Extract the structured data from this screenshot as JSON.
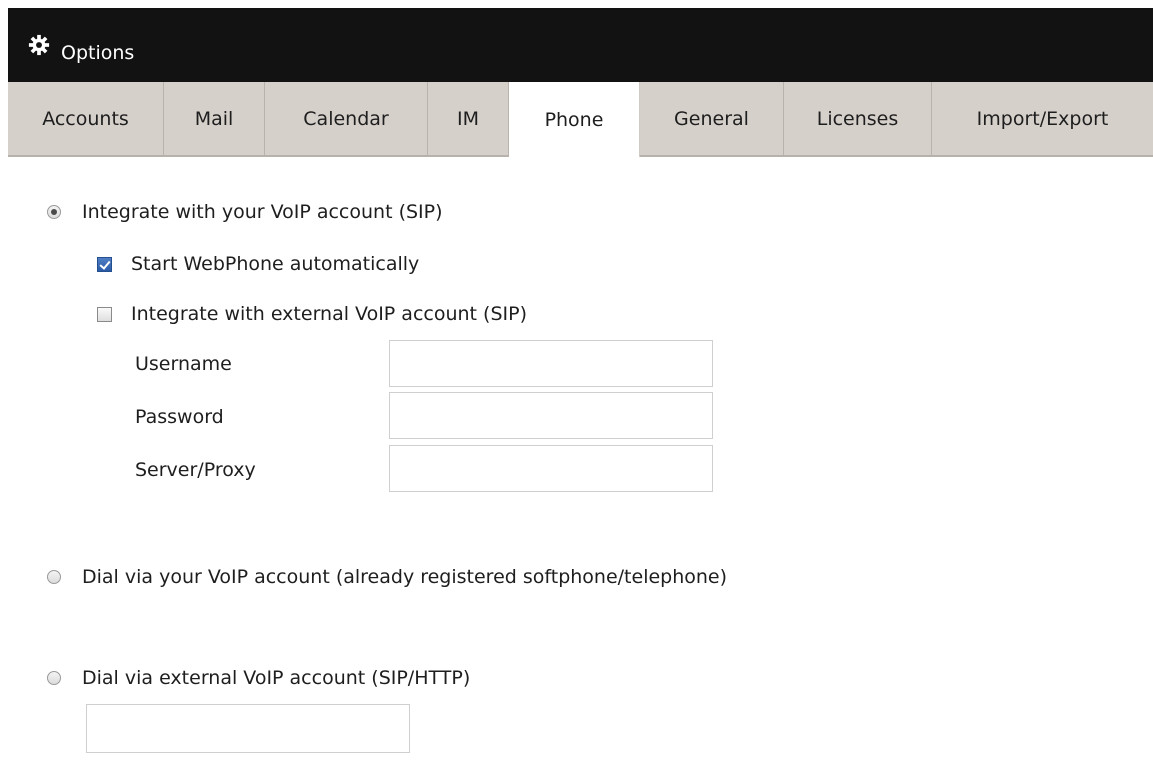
{
  "window": {
    "title": "Options",
    "icon": "gear-icon"
  },
  "tabs": [
    {
      "label": "Accounts",
      "active": false
    },
    {
      "label": "Mail",
      "active": false
    },
    {
      "label": "Calendar",
      "active": false
    },
    {
      "label": "IM",
      "active": false
    },
    {
      "label": "Phone",
      "active": true
    },
    {
      "label": "General",
      "active": false
    },
    {
      "label": "Licenses",
      "active": false
    },
    {
      "label": "Import/Export",
      "active": false
    }
  ],
  "phone": {
    "integrate_sip": {
      "label": "Integrate with your VoIP account (SIP)",
      "selected": true
    },
    "start_webphone": {
      "label": "Start WebPhone automatically",
      "checked": true
    },
    "external_sip": {
      "label": "Integrate with external VoIP account (SIP)",
      "checked": false
    },
    "fields": {
      "username": {
        "label": "Username",
        "value": ""
      },
      "password": {
        "label": "Password",
        "value": ""
      },
      "server": {
        "label": "Server/Proxy",
        "value": ""
      }
    },
    "dial_voip": {
      "label": "Dial via your VoIP account (already registered softphone/telephone)",
      "selected": false
    },
    "dial_external": {
      "label": "Dial via external VoIP account (SIP/HTTP)",
      "selected": false,
      "value": ""
    }
  },
  "colors": {
    "titlebar": "#121212",
    "tabbar": "#d6d0cb",
    "active_tab": "#ffffff",
    "checkbox_checked": "#2a5ba8"
  }
}
